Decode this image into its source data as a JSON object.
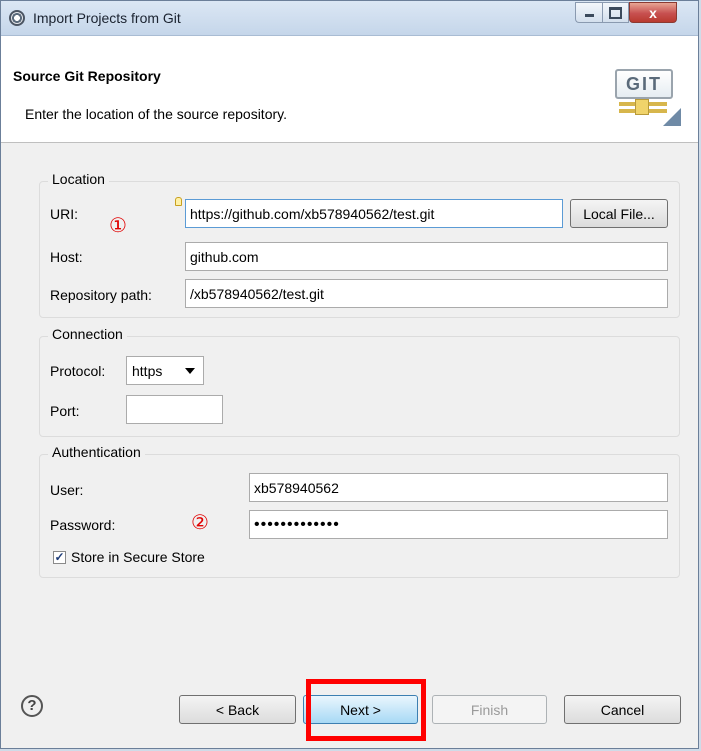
{
  "window": {
    "title": "Import Projects from Git",
    "controls": {
      "minimize": "",
      "maximize": "",
      "close": "x"
    }
  },
  "banner": {
    "title": "Source Git Repository",
    "description": "Enter the location of the source repository.",
    "logo_text": "GIT"
  },
  "location": {
    "group_label": "Location",
    "uri_label": "URI:",
    "uri_value": "https://github.com/xb578940562/test.git",
    "local_file_button": "Local File...",
    "host_label": "Host:",
    "host_value": "github.com",
    "repo_path_label": "Repository path:",
    "repo_path_value": "/xb578940562/test.git",
    "annotation": "①"
  },
  "connection": {
    "group_label": "Connection",
    "protocol_label": "Protocol:",
    "protocol_value": "https",
    "port_label": "Port:",
    "port_value": ""
  },
  "authentication": {
    "group_label": "Authentication",
    "user_label": "User:",
    "user_value": "xb578940562",
    "password_label": "Password:",
    "password_value": "•••••••••••••",
    "annotation": "②",
    "store_label": "Store in Secure Store",
    "store_checked": true
  },
  "footer": {
    "help": "?",
    "back": "< Back",
    "next": "Next >",
    "finish": "Finish",
    "cancel": "Cancel"
  },
  "colors": {
    "highlight": "#ff0000",
    "annotation": "#e00000"
  }
}
